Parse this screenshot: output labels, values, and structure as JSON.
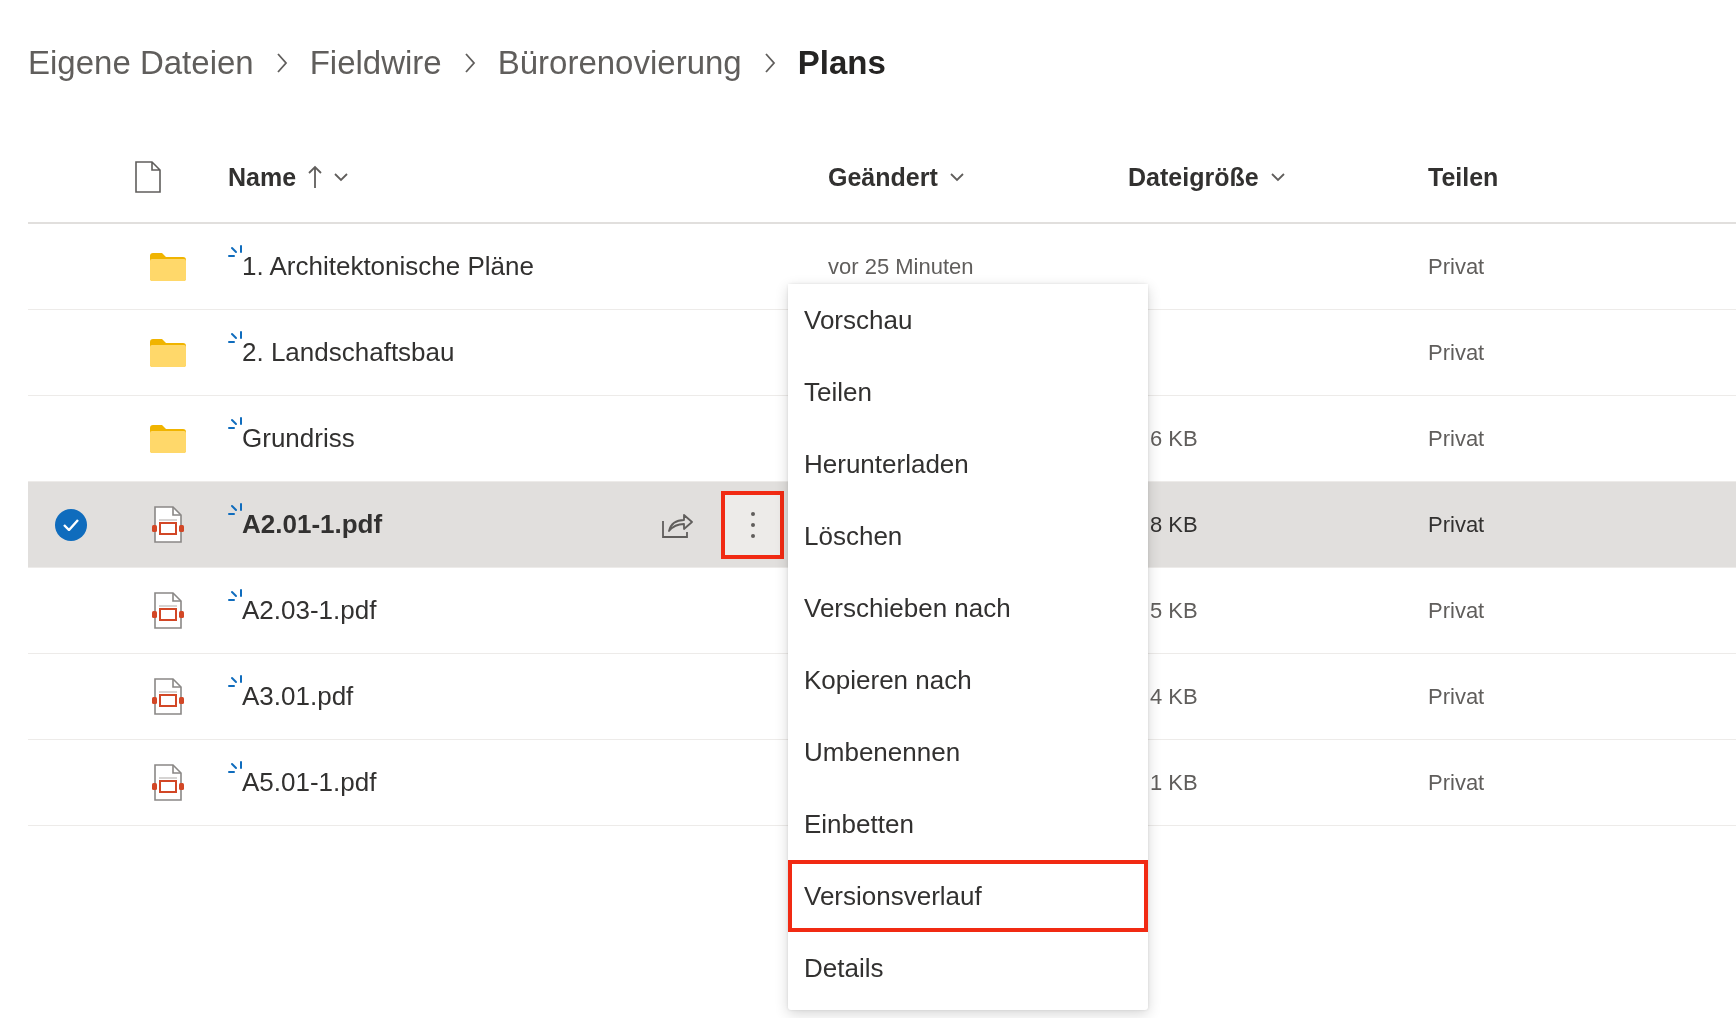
{
  "breadcrumb": [
    {
      "label": "Eigene Dateien",
      "current": false
    },
    {
      "label": "Fieldwire",
      "current": false
    },
    {
      "label": "Bürorenovierung",
      "current": false
    },
    {
      "label": "Plans",
      "current": true
    }
  ],
  "columns": [
    {
      "kind": "name",
      "label": "Name",
      "sorted": true,
      "dropdown": true
    },
    {
      "kind": "modified",
      "label": "Geändert",
      "sorted": false,
      "dropdown": true
    },
    {
      "kind": "size",
      "label": "Dateigröße",
      "sorted": false,
      "dropdown": true
    },
    {
      "kind": "sharing",
      "label": "Teilen",
      "sorted": false,
      "dropdown": false
    }
  ],
  "rows": [
    {
      "kind": "folder",
      "name": "1. Architektonische Pläne",
      "modified": "vor 25 Minuten",
      "sharing": "Privat",
      "selected": false
    },
    {
      "kind": "folder",
      "name": "2. Landschaftsbau",
      "sharing": "Privat",
      "selected": false
    },
    {
      "kind": "folder",
      "name": "Grundriss",
      "size": "6 KB",
      "sharing": "Privat",
      "selected": false
    },
    {
      "kind": "pdf",
      "name": "A2.01-1.pdf",
      "size": "8 KB",
      "sharing": "Privat",
      "selected": true,
      "more_highlighted": true
    },
    {
      "kind": "pdf",
      "name": "A2.03-1.pdf",
      "size": "5 KB",
      "sharing": "Privat",
      "selected": false
    },
    {
      "kind": "pdf",
      "name": "A3.01.pdf",
      "size": "4 KB",
      "sharing": "Privat",
      "selected": false
    },
    {
      "kind": "pdf",
      "name": "A5.01-1.pdf",
      "size": "1 KB",
      "sharing": "Privat",
      "selected": false
    }
  ],
  "context_menu": [
    {
      "label": "Vorschau",
      "highlighted": false
    },
    {
      "label": "Teilen",
      "highlighted": false
    },
    {
      "label": "Herunterladen",
      "highlighted": false
    },
    {
      "label": "Löschen",
      "highlighted": false
    },
    {
      "label": "Verschieben nach",
      "highlighted": false
    },
    {
      "label": "Kopieren nach",
      "highlighted": false
    },
    {
      "label": "Umbenennen",
      "highlighted": false
    },
    {
      "label": "Einbetten",
      "highlighted": false
    },
    {
      "label": "Versionsverlauf",
      "highlighted": true
    },
    {
      "label": "Details",
      "highlighted": false
    }
  ]
}
